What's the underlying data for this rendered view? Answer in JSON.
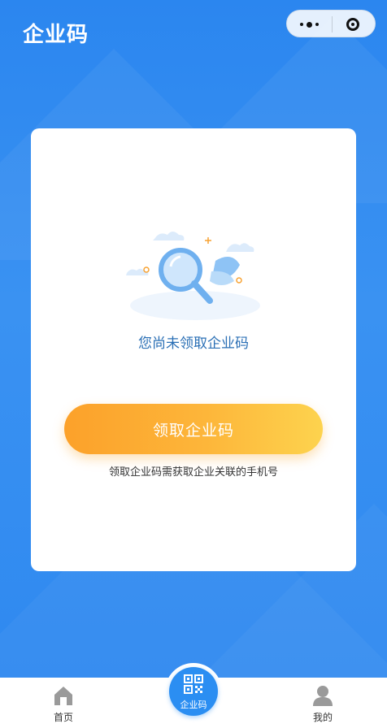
{
  "header": {
    "title": "企业码",
    "more_icon": "more-dots-icon",
    "close_icon": "target-close-icon"
  },
  "card": {
    "illustration_icon": "magnifier-leaf-illustration",
    "empty_text": "您尚未领取企业码",
    "claim_button": "领取企业码",
    "hint": "领取企业码需获取企业关联的手机号"
  },
  "tabbar": {
    "items": [
      {
        "label": "首页",
        "icon": "home-icon"
      },
      {
        "label": "企业码",
        "icon": "qr-code-icon"
      },
      {
        "label": "我的",
        "icon": "user-icon"
      }
    ],
    "active_color": "#2b8ef2"
  },
  "colors": {
    "background": "#2e8cf0",
    "accent_orange": "#fca12a",
    "text_blue": "#2a6fb5"
  }
}
